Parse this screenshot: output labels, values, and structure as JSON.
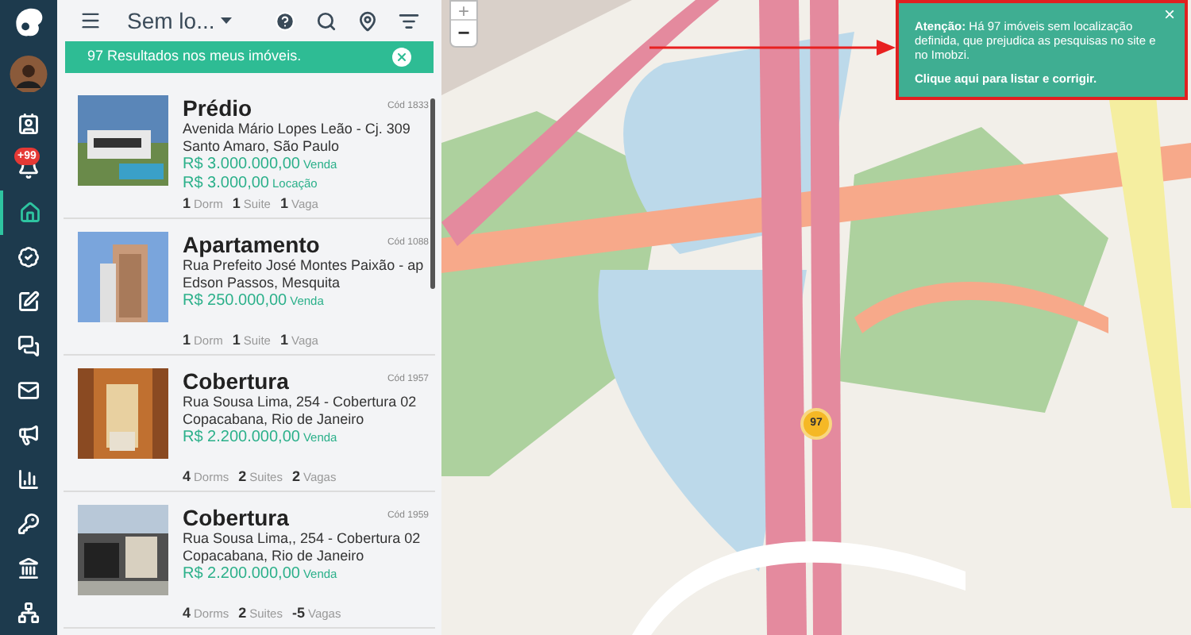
{
  "sidebar": {
    "badge": "+99",
    "items": [
      {
        "kind": "contact",
        "selected": false
      },
      {
        "kind": "notifications",
        "selected": false
      },
      {
        "kind": "home",
        "selected": true
      },
      {
        "kind": "check",
        "selected": false
      },
      {
        "kind": "edit",
        "selected": false
      },
      {
        "kind": "chat",
        "selected": false
      },
      {
        "kind": "mail",
        "selected": false
      },
      {
        "kind": "megaphone",
        "selected": false
      },
      {
        "kind": "chart",
        "selected": false
      },
      {
        "kind": "key",
        "selected": false
      },
      {
        "kind": "bank",
        "selected": false
      },
      {
        "kind": "network",
        "selected": false
      }
    ]
  },
  "header": {
    "filter_label": "Sem lo..."
  },
  "banner": {
    "text": "97 Resultados nos meus imóveis."
  },
  "listings": [
    {
      "title": "Prédio",
      "code": "Cód 1833",
      "address": "Avenida Mário Lopes Leão - Cj. 309",
      "location": "Santo Amaro, São Paulo",
      "prices": [
        {
          "amount": "R$ 3.000.000,00",
          "type": "Venda"
        },
        {
          "amount": "R$ 3.000,00",
          "type": "Locação"
        }
      ],
      "features": [
        {
          "count": "1",
          "label": "Dorm"
        },
        {
          "count": "1",
          "label": "Suite"
        },
        {
          "count": "1",
          "label": "Vaga"
        }
      ]
    },
    {
      "title": "Apartamento",
      "code": "Cód 1088",
      "address": "Rua Prefeito José Montes Paixão - ap",
      "location": "Edson Passos, Mesquita",
      "prices": [
        {
          "amount": "R$ 250.000,00",
          "type": "Venda"
        }
      ],
      "features": [
        {
          "count": "1",
          "label": "Dorm"
        },
        {
          "count": "1",
          "label": "Suite"
        },
        {
          "count": "1",
          "label": "Vaga"
        }
      ]
    },
    {
      "title": "Cobertura",
      "code": "Cód 1957",
      "address": "Rua Sousa Lima, 254 - Cobertura 02",
      "location": "Copacabana, Rio de Janeiro",
      "prices": [
        {
          "amount": "R$ 2.200.000,00",
          "type": "Venda"
        }
      ],
      "features": [
        {
          "count": "4",
          "label": "Dorms"
        },
        {
          "count": "2",
          "label": "Suites"
        },
        {
          "count": "2",
          "label": "Vagas"
        }
      ]
    },
    {
      "title": "Cobertura",
      "code": "Cód 1959",
      "address": "Rua Sousa Lima,, 254 - Cobertura 02",
      "location": "Copacabana, Rio de Janeiro",
      "prices": [
        {
          "amount": "R$ 2.200.000,00",
          "type": "Venda"
        }
      ],
      "features": [
        {
          "count": "4",
          "label": "Dorms"
        },
        {
          "count": "2",
          "label": "Suites"
        },
        {
          "count": "-5",
          "label": "Vagas"
        }
      ]
    }
  ],
  "map": {
    "zoom_in": "+",
    "zoom_out": "−",
    "marker": "97"
  },
  "alert": {
    "close": "×",
    "message": "**Atenção:** Há 97 imóveis sem localização definida, que prejudica as pesquisas no site e no Imobzi.",
    "link": "Clique aqui para listar e corrigir."
  }
}
